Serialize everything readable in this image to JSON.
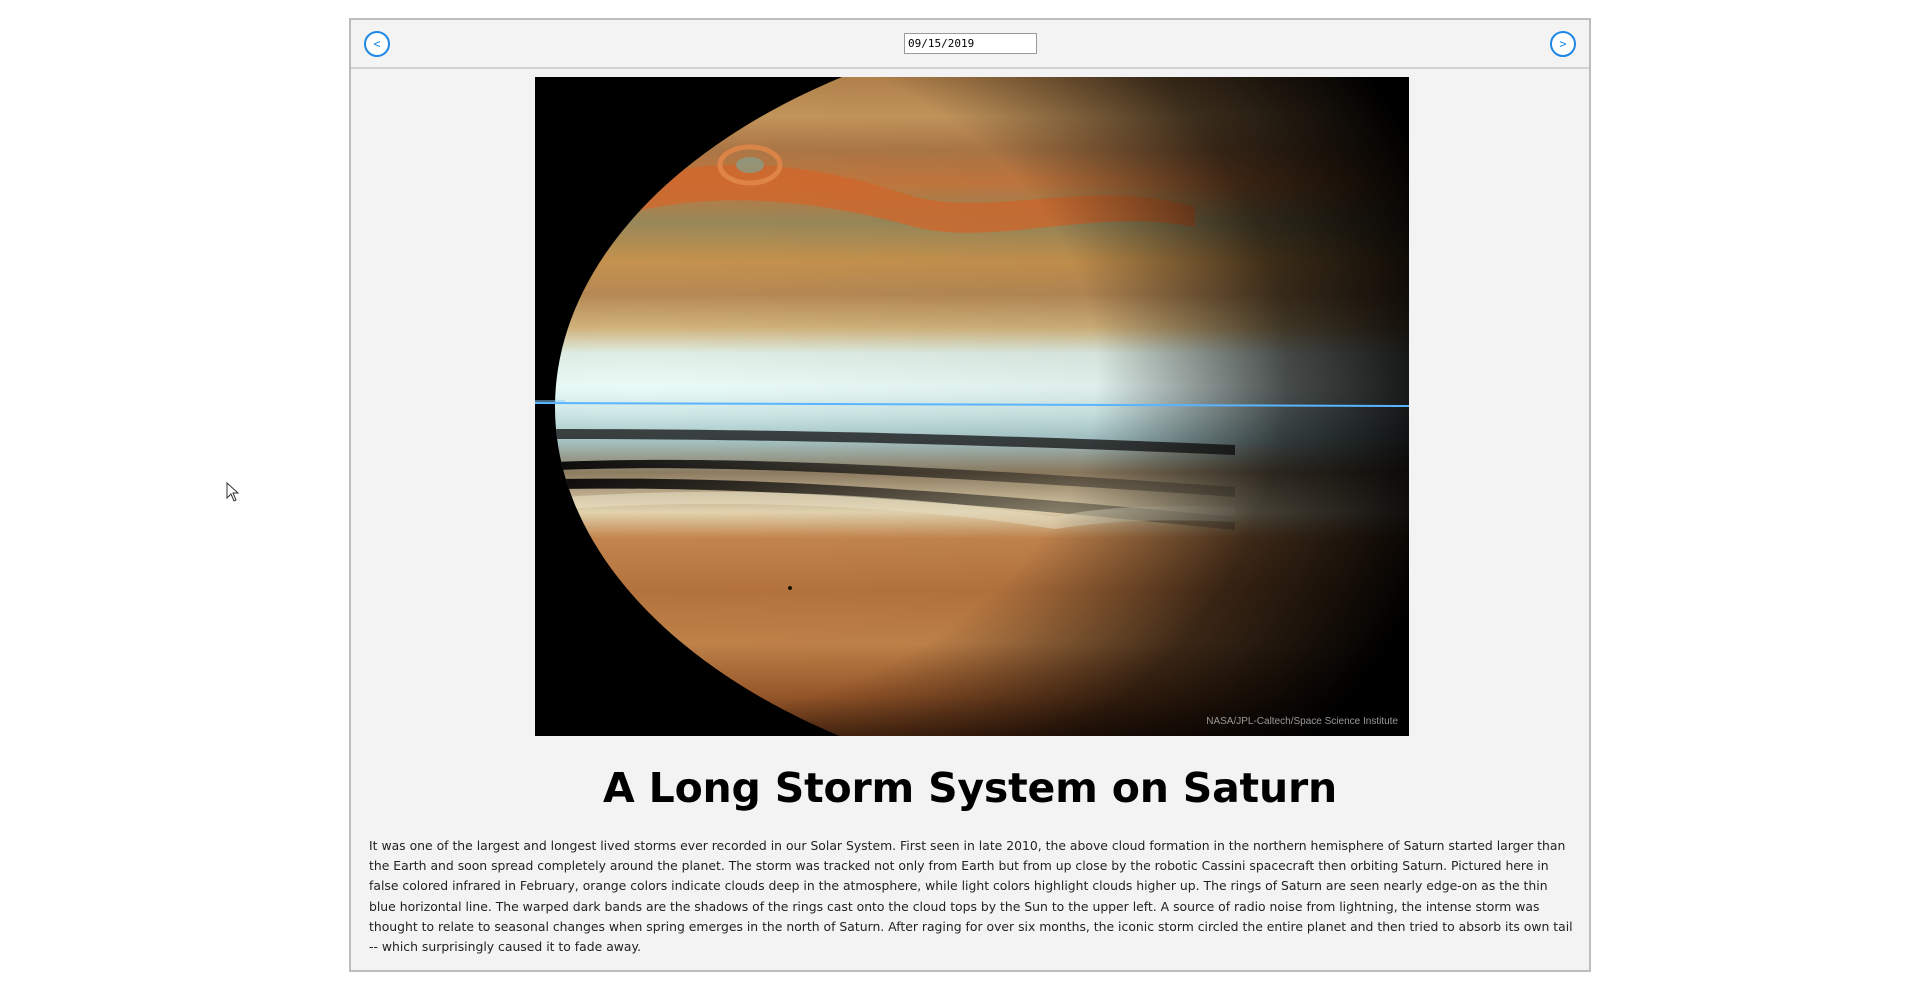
{
  "nav": {
    "prev_label": "<",
    "next_label": ">",
    "date_value": "09/15/2019"
  },
  "image": {
    "subject": "saturn-storm-infrared-photo",
    "credit": "NASA/JPL-Caltech/Space Science Institute"
  },
  "article": {
    "title": "A Long Storm System on Saturn",
    "explanation": "It was one of the largest and longest lived storms ever recorded in our Solar System. First seen in late 2010, the above cloud formation in the northern hemisphere of Saturn started larger than the Earth and soon spread completely around the planet. The storm was tracked not only from Earth but from up close by the robotic Cassini spacecraft then orbiting Saturn. Pictured here in false colored infrared in February, orange colors indicate clouds deep in the atmosphere, while light colors highlight clouds higher up. The rings of Saturn are seen nearly edge-on as the thin blue horizontal line. The warped dark bands are the shadows of the rings cast onto the cloud tops by the Sun to the upper left. A source of radio noise from lightning, the intense storm was thought to relate to seasonal changes when spring emerges in the north of Saturn. After raging for over six months, the iconic storm circled the entire planet and then tried to absorb its own tail -- which surprisingly caused it to fade away."
  },
  "colors": {
    "accent": "#1e88e5",
    "panel_bg": "#f3f3f3",
    "ring_line": "#5ab4ff"
  },
  "icons": {
    "prev": "chevron-left-icon",
    "next": "chevron-right-icon",
    "cursor": "mouse-pointer-icon"
  }
}
